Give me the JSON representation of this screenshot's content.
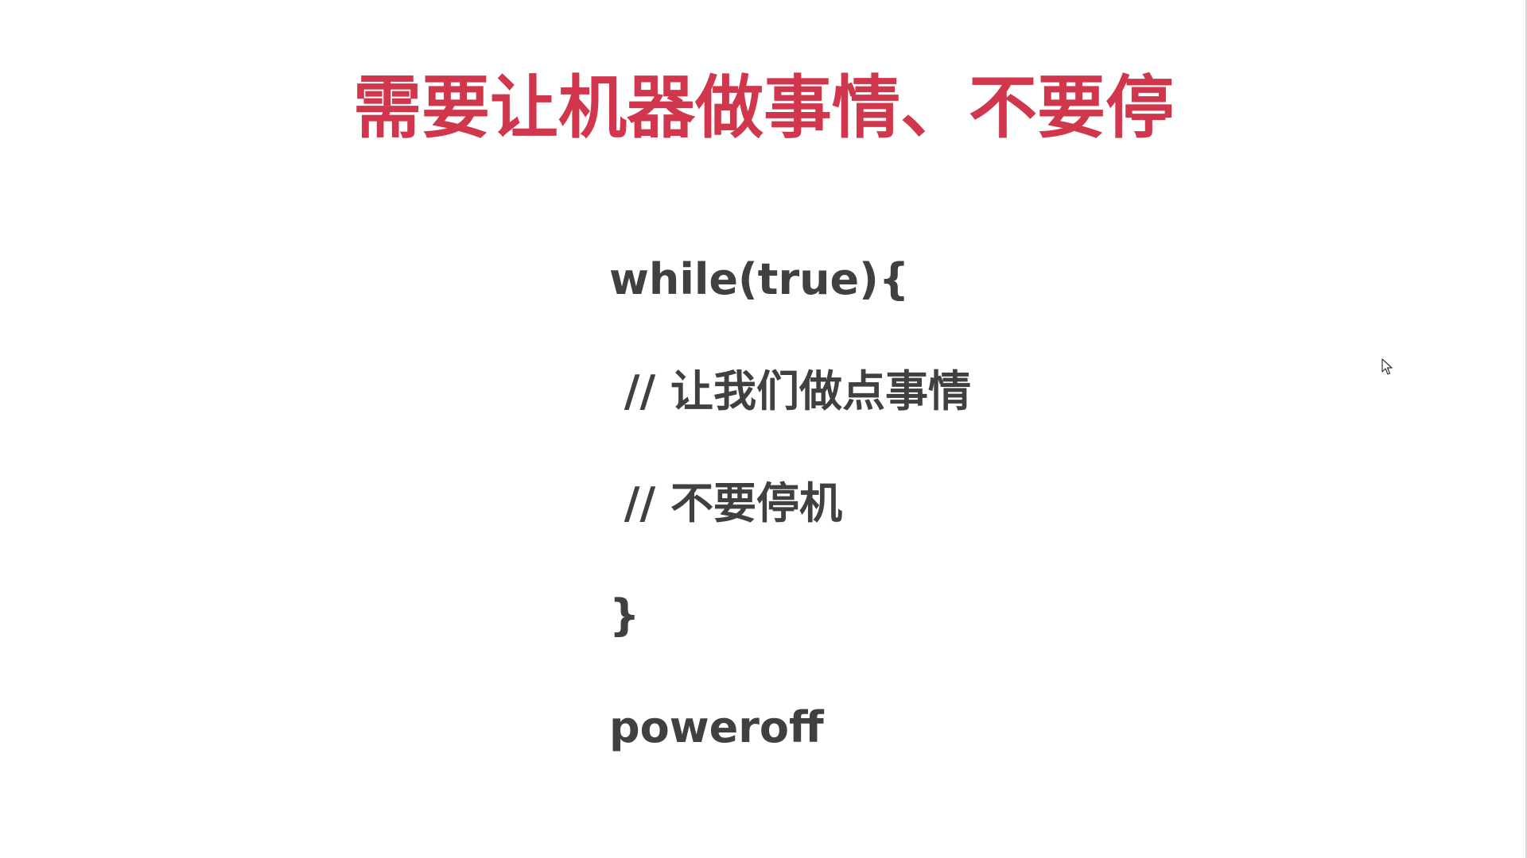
{
  "slide": {
    "title": "需要让机器做事情、不要停",
    "title_color": "#d0374d",
    "code_color": "#404040",
    "code_lines": [
      "while(true){",
      " // 让我们做点事情",
      " // 不要停机",
      "}",
      "poweroff"
    ]
  },
  "cursor": {
    "icon": "mouse-pointer-icon"
  }
}
